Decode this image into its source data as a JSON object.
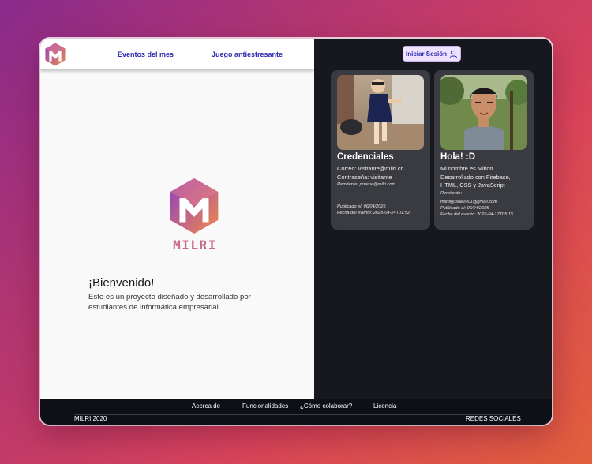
{
  "nav": {
    "links": [
      "Eventos del mes",
      "Juego antiestresante"
    ],
    "login_label": "Iniciar Sesión"
  },
  "cards": [
    {
      "title": "Credenciales",
      "lines": [
        "Correo: visitante@milri.cr",
        "Contraseña: visitante"
      ],
      "sender": "Remitente: prueba@milri.com",
      "published": "Publicado el: 06/04/2025",
      "event_date": "Fecha del evento: 2025-04-24T01:52"
    },
    {
      "title": "Hola! :D",
      "lines": [
        "Mi nombre es Milton.",
        "Desarrollado con Firebase,",
        "HTML, CSS y JavaScript"
      ],
      "sender_label": "Remitente:",
      "sender": "miltonjosue2001@gmail.com",
      "published": "Publicado el: 06/04/2025",
      "event_date": "Fecha del evento: 2025-04-17T05:16"
    }
  ],
  "hero": {
    "brand": "MILRI",
    "welcome_title": "¡Bienvenido!",
    "welcome_text": "Este es un proyecto diseñado y desarrollado por estudiantes de informática empresarial."
  },
  "footer": {
    "links": [
      "Acerca de",
      "Funcionalidades",
      "¿Cómo colaborar?",
      "Licencia"
    ],
    "copyright": "MILRI 2020",
    "social": "REDES SOCIALES"
  },
  "colors": {
    "accent": "#2a2ab0",
    "brand_pink": "#c66a87",
    "logo_gradient_start": "#8b3fc2",
    "logo_gradient_end": "#f08a4b",
    "dark_panel": "#17181d",
    "card_bg": "#3a3b40"
  },
  "icons": {
    "login": "user-icon",
    "logo": "milri-hexagon-logo"
  }
}
